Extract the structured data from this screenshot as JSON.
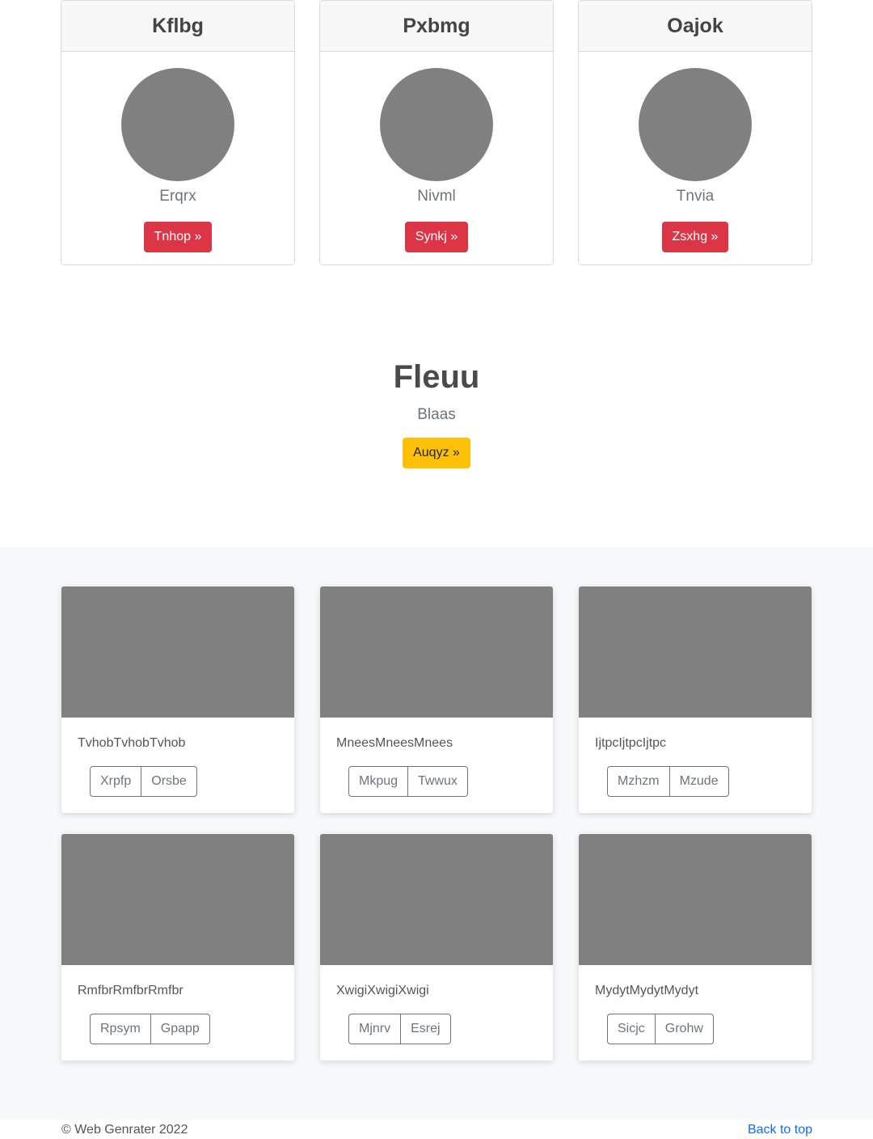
{
  "profiles": [
    {
      "title": "Kflbg",
      "name": "Erqrx",
      "button": "Tnhop »"
    },
    {
      "title": "Pxbmg",
      "name": "Nivml",
      "button": "Synkj »"
    },
    {
      "title": "Oajok",
      "name": "Tnvia",
      "button": "Zsxhg »"
    }
  ],
  "hero": {
    "title": "Fleuu",
    "subtitle": "Blaas",
    "button": "Auqyz »"
  },
  "cards": [
    {
      "title": "TvhobTvhobTvhob",
      "btn1": "Xrpfp",
      "btn2": "Orsbe"
    },
    {
      "title": "MneesMneesMnees",
      "btn1": "Mkpug",
      "btn2": "Twwux"
    },
    {
      "title": "IjtpcIjtpcIjtpc",
      "btn1": "Mzhzm",
      "btn2": "Mzude"
    },
    {
      "title": "RmfbrRmfbrRmfbr",
      "btn1": "Rpsym",
      "btn2": "Gpapp"
    },
    {
      "title": "XwigiXwigiXwigi",
      "btn1": "Mjnrv",
      "btn2": "Esrej"
    },
    {
      "title": "MydytMydytMydyt",
      "btn1": "Sicjc",
      "btn2": "Grohw"
    }
  ],
  "footer": {
    "copyright": "© Web Genrater 2022",
    "back_to_top": "Back to top"
  },
  "colors": {
    "danger": "#dc3545",
    "warning": "#ffc107",
    "link": "#0d6efd",
    "placeholder": "#808080"
  }
}
